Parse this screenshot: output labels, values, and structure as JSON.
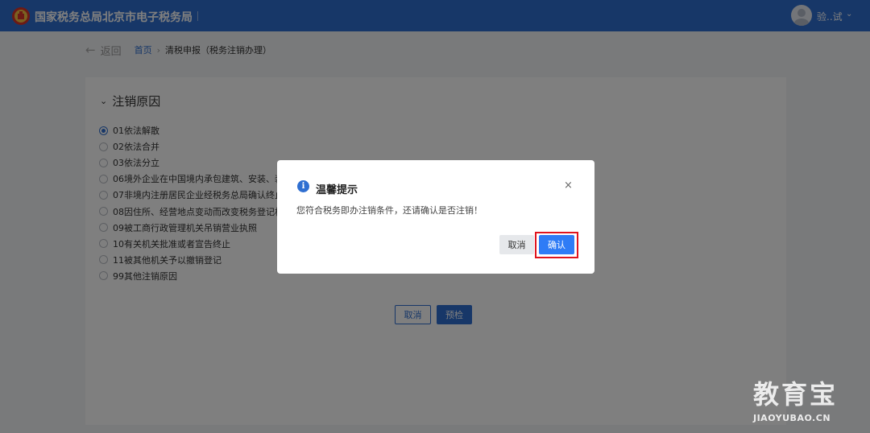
{
  "header": {
    "logo_icon": "tax-emblem-icon",
    "site_title": "国家税务总局北京市电子税务局",
    "user_name": "验..试",
    "user_caret_icon": "chevron-down-icon",
    "brand_color": "#2f6fd1"
  },
  "breadcrumb": {
    "back_icon": "arrow-left-icon",
    "back_label": "返回",
    "home": "首页",
    "separator": "›",
    "current": "清税申报（税务注销办理）"
  },
  "section": {
    "title": "注销原因",
    "reasons": [
      {
        "label": "01依法解散",
        "selected": true
      },
      {
        "label": "02依法合并",
        "selected": false
      },
      {
        "label": "03依法分立",
        "selected": false
      },
      {
        "label": "06境外企业在中国境内承包建筑、安装、装配",
        "selected": false
      },
      {
        "label": "07非境内注册居民企业经税务总局确认终止居",
        "selected": false
      },
      {
        "label": "08因住所、经营地点变动而改变税务登记机关",
        "selected": false
      },
      {
        "label": "09被工商行政管理机关吊销营业执照",
        "selected": false
      },
      {
        "label": "10有关机关批准或者宣告终止",
        "selected": false
      },
      {
        "label": "11被其他机关予以撤销登记",
        "selected": false
      },
      {
        "label": "99其他注销原因",
        "selected": false
      }
    ],
    "cancel_label": "取消",
    "precheck_label": "预检"
  },
  "modal": {
    "info_icon": "info-icon",
    "info_glyph": "i",
    "title": "温馨提示",
    "close_glyph": "×",
    "message": "您符合税务即办注销条件，还请确认是否注销！",
    "cancel_label": "取消",
    "confirm_label": "确认",
    "highlight_color": "#e0141e"
  },
  "watermark": {
    "text": "教育宝",
    "domain": "JIAOYUBAO.CN"
  }
}
